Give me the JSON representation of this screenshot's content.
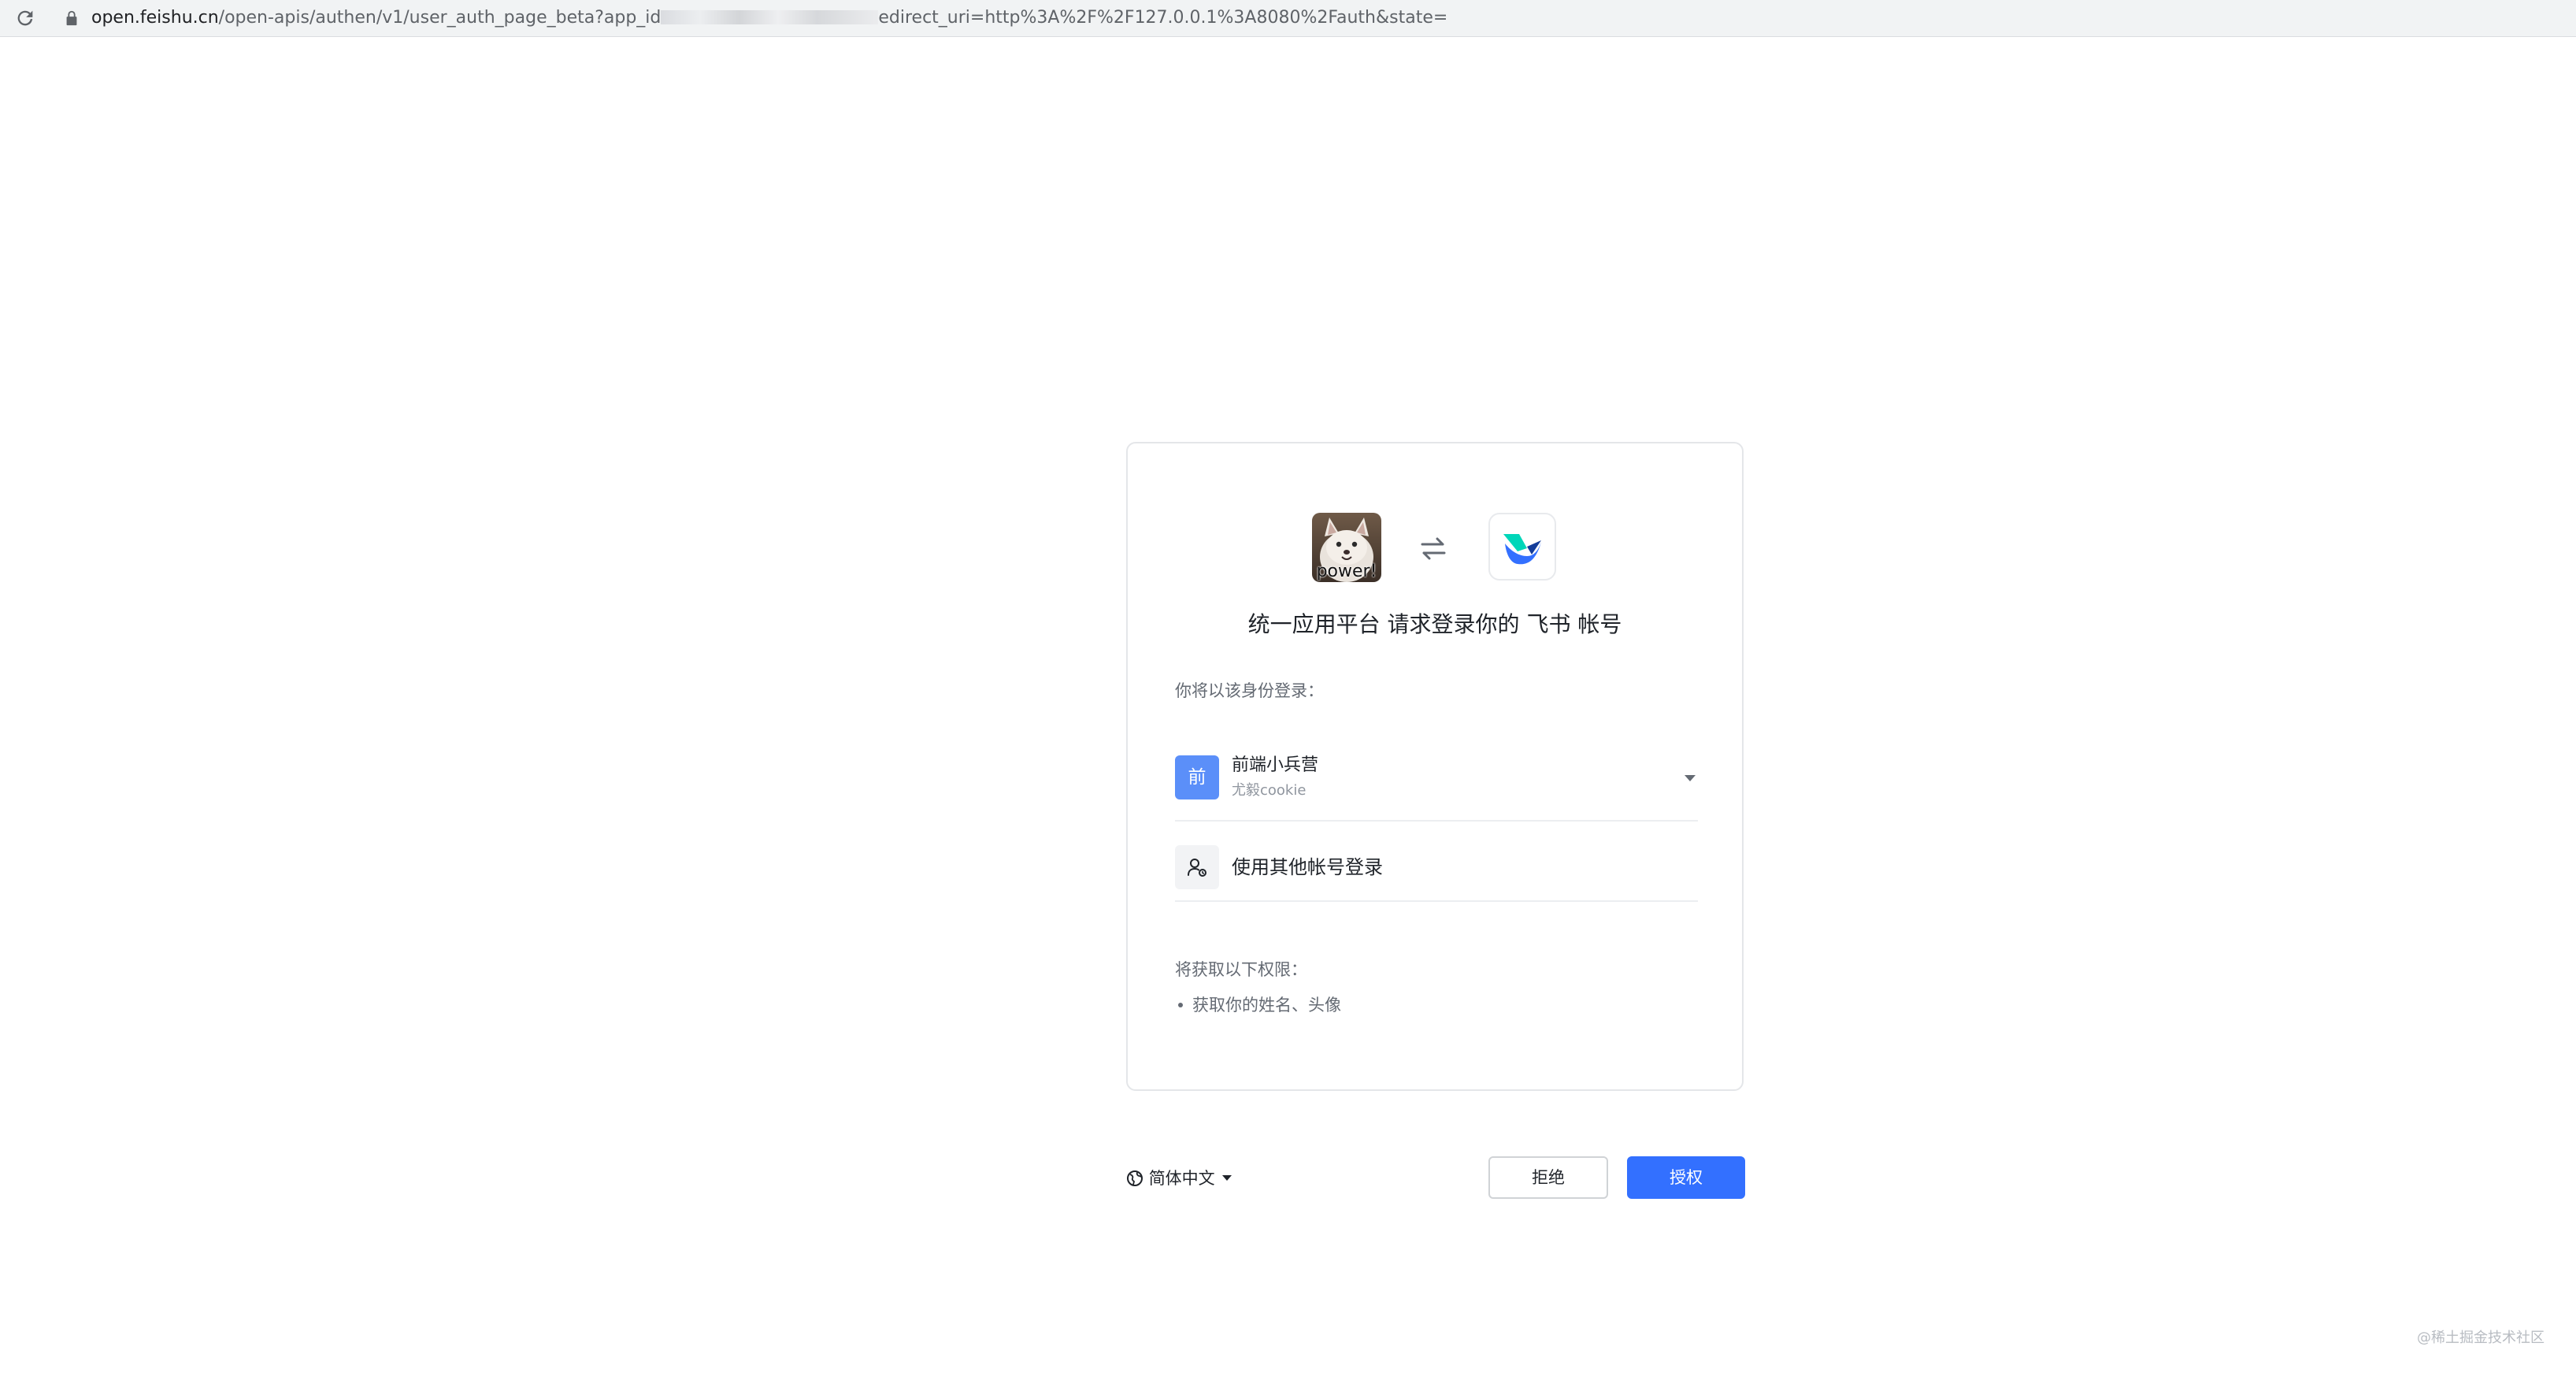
{
  "browser": {
    "url_host": "open.feishu.cn",
    "url_path": "/open-apis/authen/v1/user_auth_page_beta?app_id",
    "url_tail": "edirect_uri=http%3A%2F%2F127.0.0.1%3A8080%2Fauth&state=",
    "icons": {
      "reload": "reload-icon",
      "lock": "lock-icon"
    }
  },
  "auth": {
    "app_avatar_caption": "power!",
    "title": "统一应用平台 请求登录你的 飞书 帐号",
    "identity_label": "你将以该身份登录：",
    "account": {
      "org_icon_text": "前",
      "org_name": "前端小兵营",
      "user_name": "尤毅cookie"
    },
    "other_account_label": "使用其他帐号登录",
    "permissions_label": "将获取以下权限：",
    "permissions": [
      "获取你的姓名、头像"
    ]
  },
  "footer": {
    "language": "简体中文",
    "reject_label": "拒绝",
    "authorize_label": "授权"
  },
  "watermark": "@稀土掘金技术社区",
  "colors": {
    "primary": "#3370ff",
    "org_icon": "#5b8ff9",
    "text": "#1f2329",
    "secondary_text": "#646a73"
  }
}
